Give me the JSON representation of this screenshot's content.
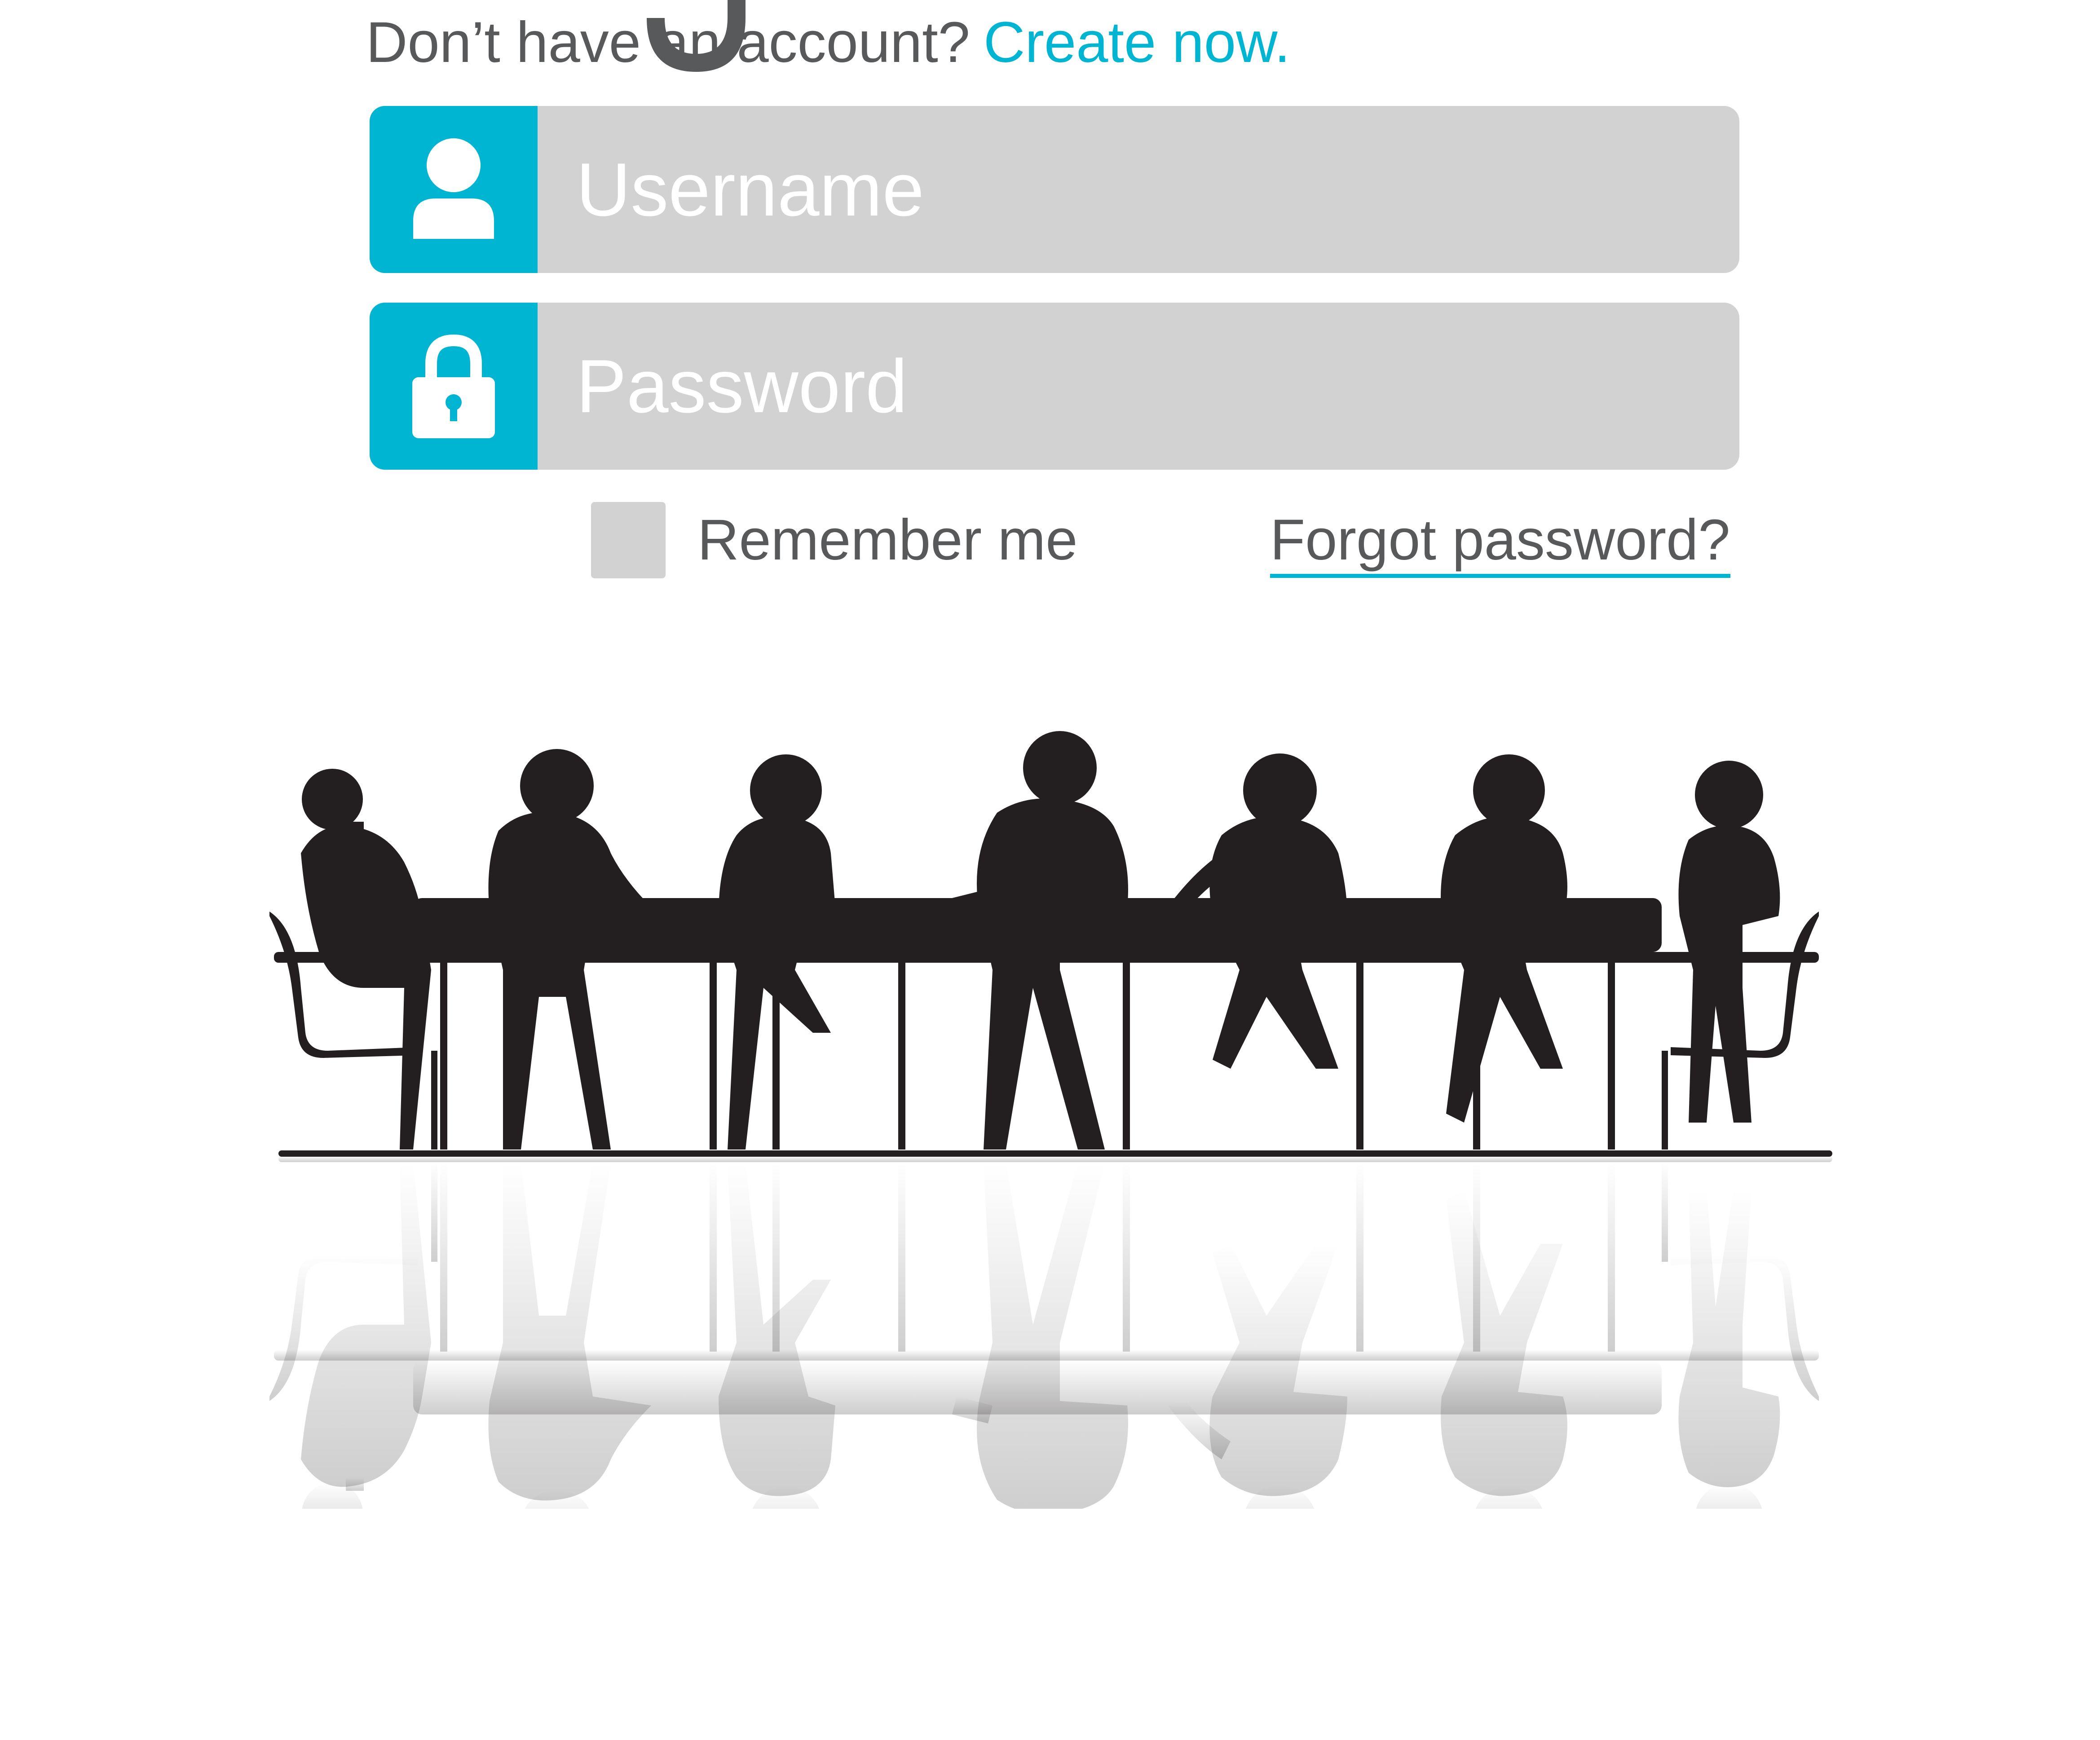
{
  "login": {
    "signup_prompt": "Don’t have an account?",
    "signup_link": "Create now.",
    "username_placeholder": "Username",
    "password_placeholder": "Password",
    "remember_label": "Remember me",
    "remember_checked": false,
    "forgot_link": "Forgot password?"
  },
  "icons": {
    "username": "user-icon",
    "password": "lock-icon"
  },
  "illustration": {
    "subject": "business-meeting-silhouettes",
    "people_count": 7
  },
  "colors": {
    "accent": "#00b5d1",
    "field_background": "#d2d2d2",
    "text": "#58595b",
    "silhouette": "#231f20",
    "background": "#ffffff"
  }
}
